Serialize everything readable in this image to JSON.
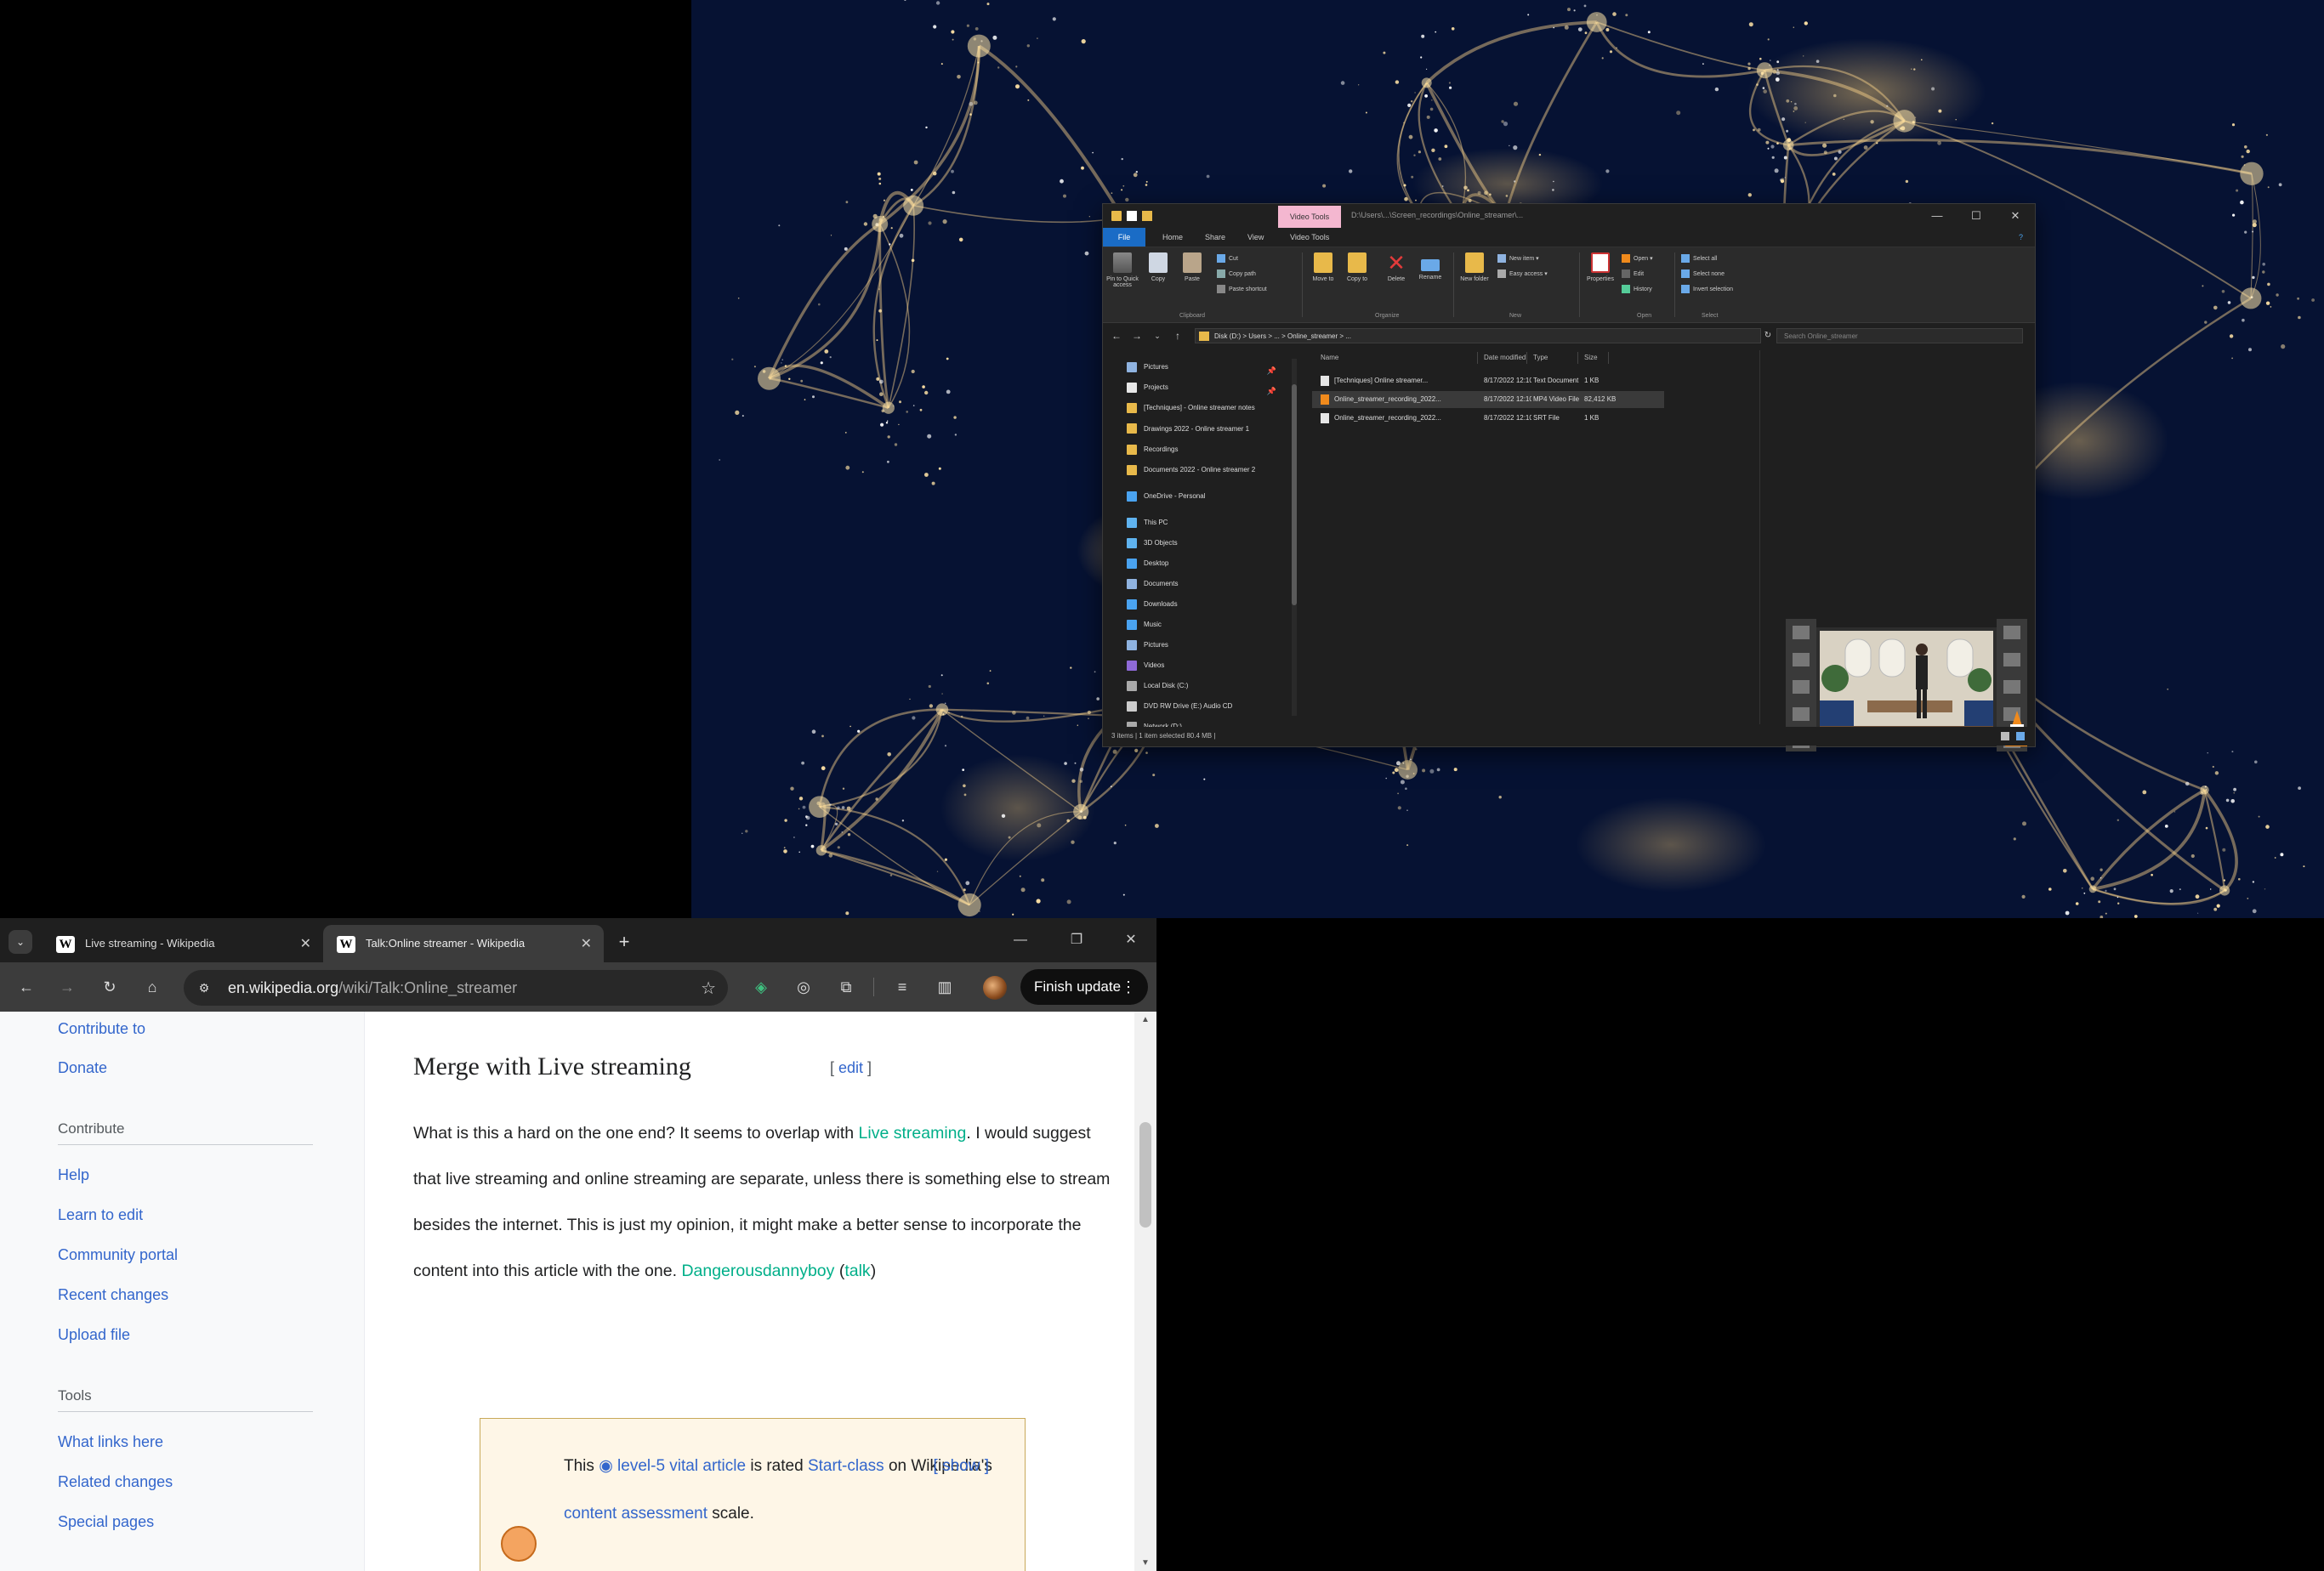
{
  "explorer": {
    "title_path": "D:\\Users\\...\\Screen_recordings\\Online_streamer\\...",
    "tool_tab": "Video Tools",
    "ribbon_tabs": [
      "File",
      "Home",
      "Share",
      "View",
      "Video Tools"
    ],
    "ribbon": {
      "clipboard": {
        "group": "Clipboard",
        "pin": "Pin to Quick access",
        "copy": "Copy",
        "paste": "Paste",
        "cut": "Cut",
        "copy_path": "Copy path",
        "paste_shortcut": "Paste shortcut"
      },
      "organize": {
        "group": "Organize",
        "move_to": "Move to",
        "copy_to": "Copy to",
        "delete": "Delete",
        "rename": "Rename"
      },
      "new": {
        "group": "New",
        "new_folder": "New folder",
        "new_item": "New item",
        "easy_access": "Easy access"
      },
      "open": {
        "group": "Open",
        "properties": "Properties",
        "open": "Open",
        "edit": "Edit",
        "history": "History"
      },
      "select": {
        "group": "Select",
        "select_all": "Select all",
        "select_none": "Select none",
        "invert": "Invert selection"
      }
    },
    "address": "Disk (D:) > Users > ... > Online_streamer > ...",
    "search_placeholder": "Search Online_streamer",
    "nav_items": [
      {
        "label": "Pictures",
        "color": "#8fb3e0",
        "pinned": true
      },
      {
        "label": "Projects",
        "color": "#e8e8e8",
        "pinned": true
      },
      {
        "label": "[Techniques] - Online streamer notes",
        "color": "#e8b94a",
        "pinned": false
      },
      {
        "label": "Drawings 2022 - Online streamer 1",
        "color": "#e8b94a",
        "pinned": false
      },
      {
        "label": "Recordings",
        "color": "#e8b94a",
        "pinned": false
      },
      {
        "label": "Documents 2022 - Online streamer 2",
        "color": "#e8b94a",
        "pinned": false
      },
      {
        "label": "OneDrive - Personal",
        "color": "#4aa3f0",
        "pinned": false
      },
      {
        "label": "This PC",
        "color": "#5fb3ef",
        "pinned": false
      },
      {
        "label": "3D Objects",
        "color": "#5fb3ef",
        "pinned": false
      },
      {
        "label": "Desktop",
        "color": "#4aa3f0",
        "pinned": false
      },
      {
        "label": "Documents",
        "color": "#8fb3e0",
        "pinned": false
      },
      {
        "label": "Downloads",
        "color": "#4aa3f0",
        "pinned": false
      },
      {
        "label": "Music",
        "color": "#4aa3f0",
        "pinned": false
      },
      {
        "label": "Pictures",
        "color": "#8fb3e0",
        "pinned": false
      },
      {
        "label": "Videos",
        "color": "#8f6ad8",
        "pinned": false
      },
      {
        "label": "Local Disk (C:)",
        "color": "#aaaaaa",
        "pinned": false
      },
      {
        "label": "DVD RW Drive (E:) Audio CD",
        "color": "#cccccc",
        "pinned": false
      },
      {
        "label": "Network (D:)",
        "color": "#aaaaaa",
        "pinned": false
      }
    ],
    "columns": [
      "Name",
      "Date modified",
      "Type",
      "Size"
    ],
    "files": [
      {
        "name": "[Techniques] Online streamer...",
        "date": "8/17/2022 12:10",
        "type": "Text Document",
        "size": "1 KB",
        "selected": false,
        "icon_color": "#e6e6e6"
      },
      {
        "name": "Online_streamer_recording_2022...",
        "date": "8/17/2022 12:10",
        "type": "MP4 Video File",
        "size": "82,412 KB",
        "selected": true,
        "icon_color": "#f08a1c"
      },
      {
        "name": "Online_streamer_recording_2022...",
        "date": "8/17/2022 12:10",
        "type": "SRT File",
        "size": "1 KB",
        "selected": false,
        "icon_color": "#e6e6e6"
      }
    ],
    "status": "3 items  |  1 item selected  80.4 MB  |"
  },
  "chrome": {
    "tabs": [
      {
        "title": "Live streaming - Wikipedia",
        "favicon": "W",
        "active": false
      },
      {
        "title": "Talk:Online streamer - Wikipedia",
        "favicon": "W",
        "active": true
      }
    ],
    "url_host": "en.wikipedia.org",
    "url_path": "/wiki/Talk:Online_streamer",
    "finish_update": "Finish update"
  },
  "wiki": {
    "sidebar_top_links": [
      "Contribute to",
      "Donate"
    ],
    "contribute_head": "Contribute",
    "contribute_links": [
      "Help",
      "Learn to edit",
      "Community portal",
      "Recent changes",
      "Upload file"
    ],
    "tools_head": "Tools",
    "tools_links": [
      "What links here",
      "Related changes",
      "Special pages"
    ],
    "section_title": "Merge with Live streaming",
    "edit_link": "edit",
    "body_parts": [
      "What is this a hard on the one end? It seems to overlap with ",
      "Live streaming",
      ". I would suggest that live streaming and online streaming are separate, unless there is something else to stream besides the internet. This is just my opinion, it might make a better sense to incorporate the content into this article with the one. ",
      "Dangerousdannyboy",
      " (",
      "talk",
      ")"
    ],
    "banner_parts": [
      "This ",
      "◉",
      " level-5 vital article",
      " is rated ",
      "Start-class",
      " on Wikipedia's ",
      "content assessment",
      " scale."
    ],
    "banner_toggle": "show"
  }
}
